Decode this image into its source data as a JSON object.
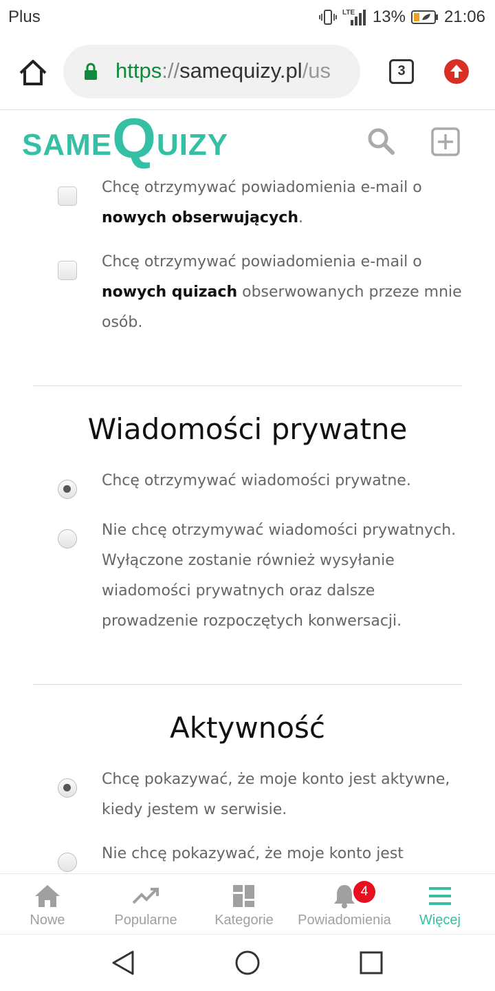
{
  "status_bar": {
    "carrier": "Plus",
    "network": "LTE",
    "battery": "13%",
    "time": "21:06"
  },
  "browser": {
    "url_scheme": "https",
    "url_separator": "://",
    "url_host": "samequizy.pl",
    "url_path": "/us",
    "tab_count": "3"
  },
  "site": {
    "logo_part1": "SAME",
    "logo_part2": "Q",
    "logo_part3": "UIZY",
    "accent_color": "#35bfa5"
  },
  "email_notifications": [
    {
      "text_before": "Chcę otrzymywać powiadomienia e-mail o ",
      "bold": "nowych obserwujących",
      "text_after": ".",
      "checked": false
    },
    {
      "text_before": "Chcę otrzymywać powiadomienia e-mail o ",
      "bold": "nowych quizach",
      "text_after": " obserwowanych przeze mnie osób.",
      "checked": false
    }
  ],
  "private_messages": {
    "title": "Wiadomości prywatne",
    "options": [
      {
        "label": "Chcę otrzymywać wiadomości prywatne.",
        "selected": true
      },
      {
        "label": "Nie chcę otrzymywać wiadomości prywatnych. Wyłączone zostanie również wysyłanie wiadomości prywatnych oraz dalsze prowadzenie rozpoczętych konwersacji.",
        "selected": false
      }
    ]
  },
  "activity": {
    "title": "Aktywność",
    "options": [
      {
        "label": "Chcę pokazywać, że moje konto jest aktywne, kiedy jestem w serwisie.",
        "selected": true
      },
      {
        "label": "Nie chcę pokazywać, że moje konto jest",
        "selected": false
      }
    ]
  },
  "bottom_nav": {
    "items": [
      {
        "label": "Nowe",
        "icon": "home-icon"
      },
      {
        "label": "Popularne",
        "icon": "trending-icon"
      },
      {
        "label": "Kategorie",
        "icon": "grid-icon"
      },
      {
        "label": "Powiadomienia",
        "icon": "bell-icon",
        "badge": "4"
      },
      {
        "label": "Więcej",
        "icon": "menu-icon",
        "active": true
      }
    ]
  }
}
